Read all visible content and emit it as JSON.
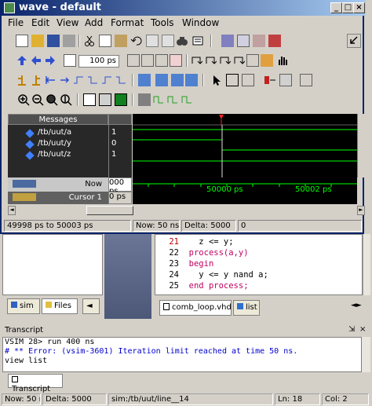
{
  "background": {
    "code": {
      "lines": [
        {
          "num": "21",
          "text": "  z <= y;",
          "num_color": "red"
        },
        {
          "num": "22",
          "text": "process(a,y)",
          "num_color": "black"
        },
        {
          "num": "23",
          "text": "begin",
          "num_color": "black"
        },
        {
          "num": "24",
          "text": "  y <= y nand a;",
          "num_color": "black"
        },
        {
          "num": "25",
          "text": "end process;",
          "num_color": "black"
        }
      ]
    },
    "left_tabs": {
      "sim": "sim",
      "files": "Files"
    },
    "code_tabs": {
      "file": "comb_loop.vhd *",
      "list": "list"
    },
    "transcript": {
      "title": "Transcript",
      "lines": [
        "VSIM 28> run 400 ns",
        "# ** Error: (vsim-3601) Iteration limit reached at time 50 ns.",
        "view list"
      ],
      "tab": "Transcript"
    },
    "status": {
      "now": "Now: 50 ns",
      "delta": "Delta: 5000",
      "path": "sim:/tb/uut/line__14",
      "ln": "Ln:",
      "ln_val": "18",
      "col": "Col: 2"
    }
  },
  "wave": {
    "title": "wave - default",
    "menu": [
      "File",
      "Edit",
      "View",
      "Add",
      "Format",
      "Tools",
      "Window"
    ],
    "zoom_value": "100 ps",
    "messages_header": "Messages",
    "signals": [
      {
        "name": "/tb/uut/a",
        "value": "1"
      },
      {
        "name": "/tb/uut/y",
        "value": "0"
      },
      {
        "name": "/tb/uut/z",
        "value": "1"
      }
    ],
    "now_label": "Now",
    "now_value": "000 ps",
    "cursor_label": "Cursor 1",
    "cursor_value": "0 ps",
    "time_ticks": [
      "50000 ps",
      "50002 ps"
    ],
    "status": {
      "range": "49998 ps to 50003 ps",
      "now": "Now: 50 ns",
      "delta": "Delta: 5000",
      "extra": "0"
    }
  },
  "colors": {
    "title_start": "#0a246a",
    "wave_green": "#00ff00",
    "error_blue": "#0000cc",
    "cursor_red": "#ff2020"
  }
}
